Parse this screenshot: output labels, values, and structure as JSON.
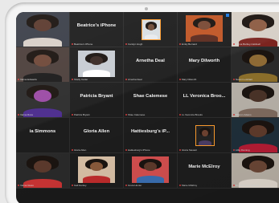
{
  "colors": {
    "screen": "#1a1a1a",
    "tile": "#1d1d1d",
    "active_border": "#ff9d2e",
    "mic_off": "#d23b3b",
    "flag": "#1e7ae0"
  },
  "tiles": [
    {
      "name": "",
      "label": "",
      "kind": "photo",
      "photo_bg": "#3b3f49",
      "skin": "#5b3a2e",
      "shirt": "#d8d0c8",
      "flag": false
    },
    {
      "name": "Beatrice's iPhone",
      "label": "Beatrice's iPhone",
      "kind": "name",
      "flag": false
    },
    {
      "name": "",
      "label": "Carolyn Hugh",
      "kind": "photo-small",
      "photo_bg": "#d9dfe2",
      "skin": "#6f4b36",
      "shirt": "#e8eaec",
      "flag": false
    },
    {
      "name": "",
      "label": "Emily Bernard",
      "kind": "photo-medium",
      "photo_bg": "#c05626",
      "skin": "#7a4a35",
      "shirt": "#5c2b1f",
      "flag": true
    },
    {
      "name": "",
      "label": "Velma Bartley-Caldwell",
      "kind": "photo",
      "photo_bg": "#d6cfc6",
      "skin": "#8d5c43",
      "shirt": "#7b241f",
      "flag": true
    },
    {
      "name": "",
      "label": "Velma Edwards",
      "kind": "photo",
      "photo_bg": "#4c3f3b",
      "skin": "#6f4838",
      "shirt": "#1b1a1a",
      "flag": false
    },
    {
      "name": "",
      "label": "Shelly Carter",
      "kind": "photo-medium",
      "photo_bg": "#c7ccd2",
      "skin": "#3a2a24",
      "shirt": "#ffffff",
      "flag": false
    },
    {
      "name": "Arnetha Deal",
      "label": "Arnetha Deal",
      "kind": "name",
      "flag": false
    },
    {
      "name": "Mary Dilworth",
      "label": "Mary Dilworth",
      "kind": "name",
      "flag": false
    },
    {
      "name": "",
      "label": "Naomi Lockhart",
      "kind": "photo",
      "photo_bg": "#2a2a2a",
      "skin": "#8f6b35",
      "shirt": "#8c6f2b",
      "flag": false
    },
    {
      "name": "",
      "label": "Velma Ross",
      "kind": "photo",
      "photo_bg": "#2c2c2c",
      "skin": "#9b4aa5",
      "shirt": "#4a2a8c",
      "flag": false
    },
    {
      "name": "Patricia Bryant",
      "label": "Patricia Bryant",
      "kind": "name",
      "flag": false
    },
    {
      "name": "Shae Calemese",
      "label": "Shae Calemese",
      "kind": "name",
      "flag": false
    },
    {
      "name": "LL Veronica Broo...",
      "label": "LL Veronica Brooks",
      "kind": "name",
      "flag": false
    },
    {
      "name": "",
      "label": "Sharon Adams",
      "kind": "photo",
      "photo_bg": "#b7b1a8",
      "skin": "#4a3328",
      "shirt": "#7f6b5f",
      "flag": false
    },
    {
      "name": "ia Simmons",
      "label": "",
      "kind": "name",
      "flag": false
    },
    {
      "name": "Gloria Allen",
      "label": "Gloria Allen",
      "kind": "name",
      "flag": false
    },
    {
      "name": "Hattiesburg's iP...",
      "label": "Hattiesburg's iPhone",
      "kind": "name",
      "flag": false
    },
    {
      "name": "",
      "label": "Gloria Stewart",
      "kind": "photo-small",
      "photo_bg": "#232323",
      "skin": "#6e4331",
      "shirt": "#4c3d65",
      "flag": false
    },
    {
      "name": "",
      "label": "Lillie Fleming",
      "kind": "photo",
      "photo_bg": "#1f2f3a",
      "skin": "#5f3b2c",
      "shirt": "#b51c34",
      "flag": false
    },
    {
      "name": "",
      "label": "Velma Glass",
      "kind": "photo",
      "photo_bg": "#2a2a2a",
      "skin": "#5c3a2d",
      "shirt": "#c93434",
      "flag": false
    },
    {
      "name": "",
      "label": "Gail Henley",
      "kind": "photo-medium",
      "photo_bg": "#d8c0a6",
      "skin": "#8a5a3c",
      "shirt": "#bf2c2c",
      "flag": false
    },
    {
      "name": "",
      "label": "Greta Hunter",
      "kind": "photo-medium",
      "photo_bg": "#d44f4f",
      "skin": "#5e3a2c",
      "shirt": "#3a6fb2",
      "flag": false
    },
    {
      "name": "Marie McElroy",
      "label": "Marie McElroy",
      "kind": "name",
      "flag": false
    },
    {
      "name": "",
      "label": "Crystal Olivia Thomas",
      "kind": "photo",
      "photo_bg": "#b8b0a5",
      "skin": "#6b4736",
      "shirt": "#e1d9cf",
      "flag": false
    }
  ]
}
